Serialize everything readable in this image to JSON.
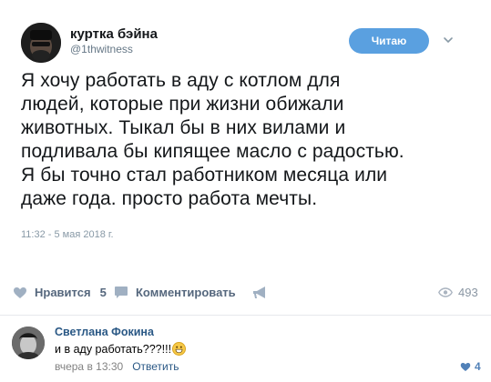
{
  "tweet": {
    "author_name": "куртка бэйна",
    "author_handle": "@1thwitness",
    "follow_label": "Читаю",
    "lines": [
      "Я хочу работать в аду с котлом для",
      "людей, которые при жизни обижали",
      "животных. Тыкал бы в них вилами и",
      "подливала бы кипящее масло с радостью.",
      "Я бы точно стал работником месяца или",
      "даже года. просто работа мечты."
    ],
    "timestamp": "11:32 - 5 мая 2018 г."
  },
  "actions": {
    "like_label": "Нравится",
    "like_count": "5",
    "comment_label": "Комментировать",
    "views_count": "493"
  },
  "comment": {
    "author": "Светлана Фокина",
    "text": "и в аду работать???!!!",
    "time": "вчера в 13:30",
    "reply_label": "Ответить",
    "likes": "4"
  },
  "colors": {
    "follow_button": "#5aa0e0",
    "link": "#2a5885",
    "action_text": "#55677d"
  }
}
